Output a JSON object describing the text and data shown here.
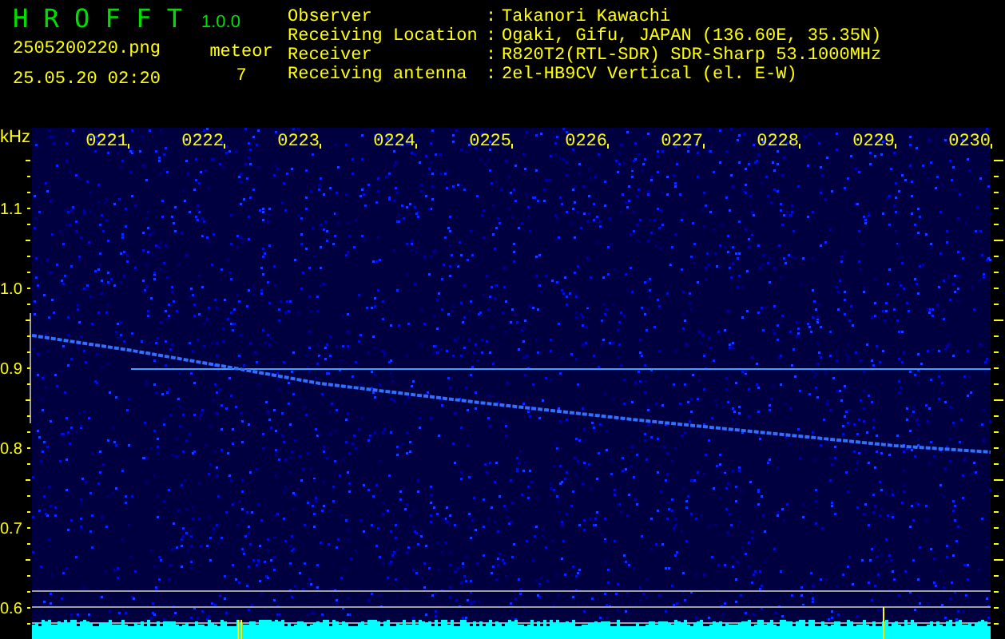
{
  "app": {
    "title": "H R O F F T",
    "version": "1.0.0"
  },
  "file": {
    "name": "2505200220.png",
    "datetime": "25.05.20 02:20"
  },
  "detection": {
    "label": "meteor",
    "count": "7"
  },
  "station": [
    {
      "label": "Observer",
      "separator": ":",
      "value": "Takanori Kawachi"
    },
    {
      "label": "Receiving Location",
      "separator": ":",
      "value": "Ogaki, Gifu, JAPAN (136.60E, 35.35N)"
    },
    {
      "label": "Receiver",
      "separator": ":",
      "value": "R820T2(RTL-SDR) SDR-Sharp 53.1000MHz"
    },
    {
      "label": "Receiving antenna",
      "separator": ":",
      "value": "2el-HB9CV Vertical (el. E-W)"
    }
  ],
  "spectrogram": {
    "unit": "kHz",
    "time_labels": [
      "0221",
      "0222",
      "0223",
      "0224",
      "0225",
      "0226",
      "0227",
      "0228",
      "0229",
      "0230"
    ],
    "freq_labels": [
      "1.1",
      "1.0",
      "0.9",
      "0.8",
      "0.7",
      "0.6"
    ]
  }
}
